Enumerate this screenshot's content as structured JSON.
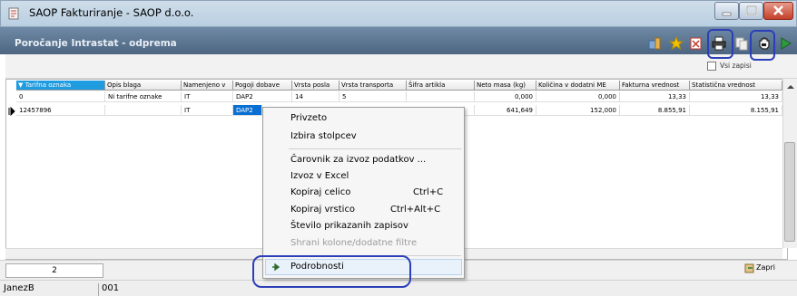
{
  "window": {
    "title": "SAOP Fakturiranje - SAOP d.o.o."
  },
  "form": {
    "title": "Poročanje Intrastat - odprema"
  },
  "toolbar": {
    "vsi_zapisi_label": "Vsi zapisi"
  },
  "grid": {
    "columns": [
      "Tarifna oznaka",
      "Opis blaga",
      "Namenjeno v",
      "Pogoji dobave",
      "Vrsta posla",
      "Vrsta transporta",
      "Šifra artikla",
      "Neto masa (kg)",
      "Količina v dodatni ME",
      "Fakturna vrednost",
      "Statistična vrednost"
    ],
    "rows": [
      {
        "tarifna": "0",
        "opis": "Ni tarifne oznake",
        "namenjeno": "IT",
        "pogoji": "DAP2",
        "vrsta_posla": "14",
        "vrsta_transporta": "5",
        "sifra": "",
        "neto": "0,000",
        "kolicina": "0,000",
        "fakturna": "13,33",
        "statisticna": "13,33"
      },
      {
        "tarifna": "12457896",
        "opis": "",
        "namenjeno": "IT",
        "pogoji": "DAP2",
        "vrsta_posla": "",
        "vrsta_transporta": "",
        "sifra": "",
        "neto": "641,649",
        "kolicina": "152,000",
        "fakturna": "8.855,91",
        "statisticna": "8.155,91"
      }
    ]
  },
  "footer": {
    "record_count": "2",
    "close_label": "Zapri",
    "user": "JanezB",
    "code": "001"
  },
  "context_menu": {
    "items": [
      {
        "label": "Privzeto",
        "shortcut": ""
      },
      {
        "label": "Izbira stolpcev",
        "shortcut": ""
      },
      {
        "label": "Čarovnik za izvoz podatkov ...",
        "shortcut": ""
      },
      {
        "label": "Izvoz v Excel",
        "shortcut": ""
      },
      {
        "label": "Kopiraj celico",
        "shortcut": "Ctrl+C"
      },
      {
        "label": "Kopiraj vrstico",
        "shortcut": "Ctrl+Alt+C"
      },
      {
        "label": "Število prikazanih zapisov",
        "shortcut": ""
      },
      {
        "label": "Shrani kolone/dodatne filtre",
        "shortcut": "",
        "disabled": true
      },
      {
        "label": "Podrobnosti",
        "shortcut": ""
      }
    ]
  },
  "colors": {
    "header_band": "#5a7590",
    "selection": "#0a6fd3",
    "sorted_header": "#1f9be0",
    "annotation": "#2c3fb8"
  },
  "icons": [
    "app-icon",
    "print-icon",
    "star-icon",
    "close-doc-icon",
    "copy-icon",
    "hand-icon",
    "next-icon",
    "exit-icon",
    "row-pointer-icon",
    "arrow-right-icon"
  ]
}
